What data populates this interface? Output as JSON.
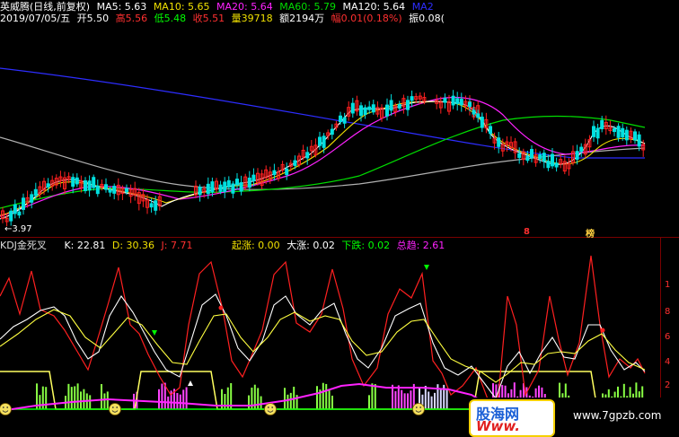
{
  "header": {
    "stock_name": "英威腾(日线,前复权)",
    "ma5": "MA5: 5.63",
    "ma10": "MA10: 5.65",
    "ma20": "MA20: 5.64",
    "ma60": "MA60: 5.79",
    "ma120": "MA120: 5.64",
    "ma250_cut": "MA2"
  },
  "ohlc": {
    "date": "2019/07/05/五",
    "open": "开5.50",
    "high": "高5.56",
    "low": "低5.48",
    "close": "收5.51",
    "volume": "量39718",
    "amount": "额2194万",
    "change": "幅0.01(0.18%)",
    "amplitude": "振0.08("
  },
  "price_panel": {
    "low_marker": "←3.97",
    "tag1": "8",
    "tag2": "榜"
  },
  "kdj": {
    "title": "KDJ金死叉",
    "k": "K: 22.81",
    "d": "D: 30.36",
    "j": "J: 7.71",
    "qizhang": "起涨: 0.00",
    "dazhang": "大涨: 0.02",
    "xiadie": "下跌: 0.02",
    "zongqu": "总趋: 2.61",
    "ticks": [
      "1",
      "8",
      "6",
      "4",
      "2"
    ]
  },
  "watermark": {
    "logo_cn": "股海网",
    "logo_www": "Www.",
    "url": "www.7gpzb.com"
  },
  "colors": {
    "ma5": "#ffffff",
    "ma10": "#f0e000",
    "ma20": "#ff00ff",
    "ma60": "#00ff00",
    "ma120": "#aaaaaa",
    "ma250": "#2d2dff",
    "up": "#ff2020",
    "down": "#00e0e0",
    "k_line": "#ffffff",
    "d_line": "#ffff40",
    "j_line": "#ff2020"
  }
}
